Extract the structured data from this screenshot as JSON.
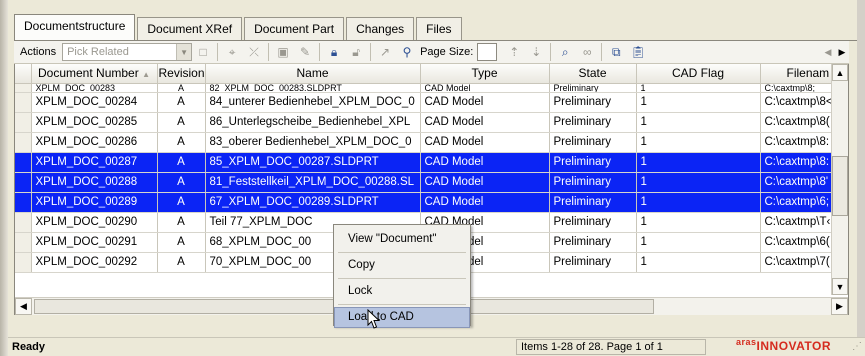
{
  "tabs": [
    {
      "label": "Documentstructure",
      "active": true
    },
    {
      "label": "Document XRef"
    },
    {
      "label": "Document Part"
    },
    {
      "label": "Changes"
    },
    {
      "label": "Files"
    }
  ],
  "toolbar": {
    "actions_label": "Actions",
    "pick_related": "Pick Related",
    "page_size_label": "Page Size:",
    "page_size_value": ""
  },
  "grid": {
    "columns": [
      "Document Number",
      "Revision",
      "Name",
      "Type",
      "State",
      "CAD Flag",
      "Filenam"
    ],
    "sort_column": "Document Number",
    "rows": [
      {
        "num": "XPLM_DOC_00283",
        "rev": "A",
        "name": "82_XPLM_DOC_00283.SLDPRT",
        "type": "CAD Model",
        "state": "Preliminary",
        "flag": "1",
        "file": "C:\\caxtmp\\8;",
        "partial": true
      },
      {
        "num": "XPLM_DOC_00284",
        "rev": "A",
        "name": "84_unterer Bedienhebel_XPLM_DOC_0",
        "type": "CAD Model",
        "state": "Preliminary",
        "flag": "1",
        "file": "C:\\caxtmp\\8<"
      },
      {
        "num": "XPLM_DOC_00285",
        "rev": "A",
        "name": "86_Unterlegscheibe_Bedienhebel_XPL",
        "type": "CAD Model",
        "state": "Preliminary",
        "flag": "1",
        "file": "C:\\caxtmp\\8("
      },
      {
        "num": "XPLM_DOC_00286",
        "rev": "A",
        "name": "83_oberer Bedienhebel_XPLM_DOC_0",
        "type": "CAD Model",
        "state": "Preliminary",
        "flag": "1",
        "file": "C:\\caxtmp\\8:"
      },
      {
        "num": "XPLM_DOC_00287",
        "rev": "A",
        "name": "85_XPLM_DOC_00287.SLDPRT",
        "type": "CAD Model",
        "state": "Preliminary",
        "flag": "1",
        "file": "C:\\caxtmp\\8:",
        "selected": true
      },
      {
        "num": "XPLM_DOC_00288",
        "rev": "A",
        "name": "81_Feststellkeil_XPLM_DOC_00288.SL",
        "type": "CAD Model",
        "state": "Preliminary",
        "flag": "1",
        "file": "C:\\caxtmp\\8'",
        "selected": true
      },
      {
        "num": "XPLM_DOC_00289",
        "rev": "A",
        "name": "67_XPLM_DOC_00289.SLDPRT",
        "type": "CAD Model",
        "state": "Preliminary",
        "flag": "1",
        "file": "C:\\caxtmp\\6;",
        "selected": true
      },
      {
        "num": "XPLM_DOC_00290",
        "rev": "A",
        "name": "Teil 77_XPLM_DOC",
        "type": "CAD Model",
        "state": "Preliminary",
        "flag": "1",
        "file": "C:\\caxtmp\\T‹"
      },
      {
        "num": "XPLM_DOC_00291",
        "rev": "A",
        "name": "68_XPLM_DOC_00",
        "type": "CAD Model",
        "state": "Preliminary",
        "flag": "1",
        "file": "C:\\caxtmp\\6("
      },
      {
        "num": "XPLM_DOC_00292",
        "rev": "A",
        "name": "70_XPLM_DOC_00",
        "type": "CAD Model",
        "state": "Preliminary",
        "flag": "1",
        "file": "C:\\caxtmp\\7("
      }
    ]
  },
  "context_menu": {
    "items": [
      "View \"Document\"",
      "Copy",
      "Lock",
      "Load to CAD"
    ],
    "hovered": "Load to CAD"
  },
  "status": {
    "ready": "Ready",
    "items": "Items 1-28 of 28. Page 1 of 1",
    "brand_top": "aras",
    "brand": "INNOVATOR"
  },
  "colors": {
    "selection": "#0b24f5",
    "menu_hover": "#b6c4e0",
    "brand": "#d52b1e"
  }
}
